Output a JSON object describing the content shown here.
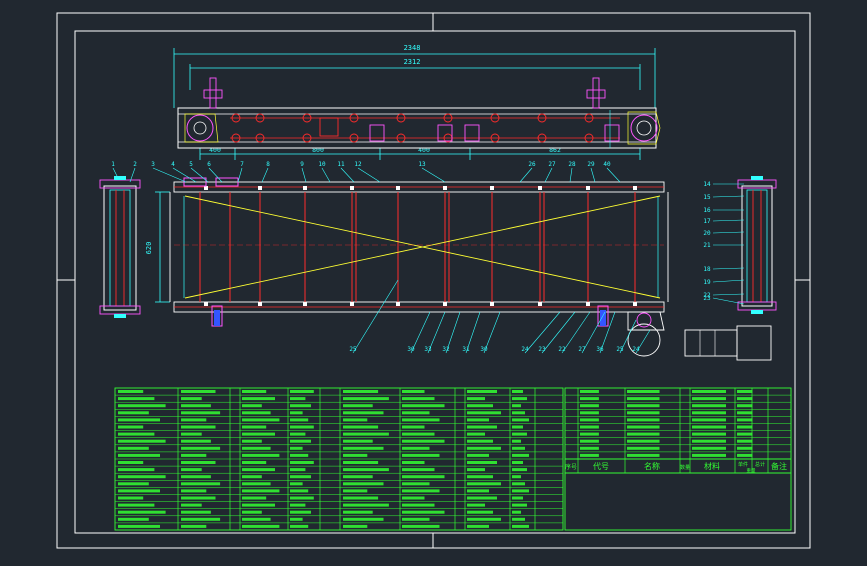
{
  "dimensions": {
    "overall_top": "2348",
    "overall_second": "2312",
    "seg_1": "400",
    "seg_2": "800",
    "seg_3": "400",
    "seg_4": "862",
    "height_label": "620"
  },
  "balloons_top": [
    "1",
    "2",
    "3",
    "4",
    "5",
    "6",
    "7",
    "8",
    "9",
    "10",
    "11",
    "12",
    "13",
    "26",
    "27",
    "28",
    "29",
    "40"
  ],
  "balloons_bottom": [
    "25",
    "30",
    "33",
    "32",
    "31",
    "30",
    "24",
    "23",
    "22",
    "27",
    "36",
    "25",
    "24"
  ],
  "balloons_right": [
    "14",
    "15",
    "16",
    "17",
    "20",
    "21",
    "18",
    "19",
    "22",
    "23"
  ],
  "title_block": {
    "col_seq": "序号",
    "col_code": "代号",
    "col_name": "名称",
    "col_qty": "数量",
    "col_material": "材料",
    "col_unit": "单件",
    "col_total": "总计",
    "col_weight": "重量",
    "col_remark": "备注"
  },
  "colors": {
    "background": "#212830",
    "frame": "#ffffff",
    "belt": "#ff2b2b",
    "center_lines": "#ffff33",
    "parts_list": "#33ff33",
    "dimensions": "#33ffff",
    "components": "#ff55ff",
    "motor": "#ffffff"
  }
}
